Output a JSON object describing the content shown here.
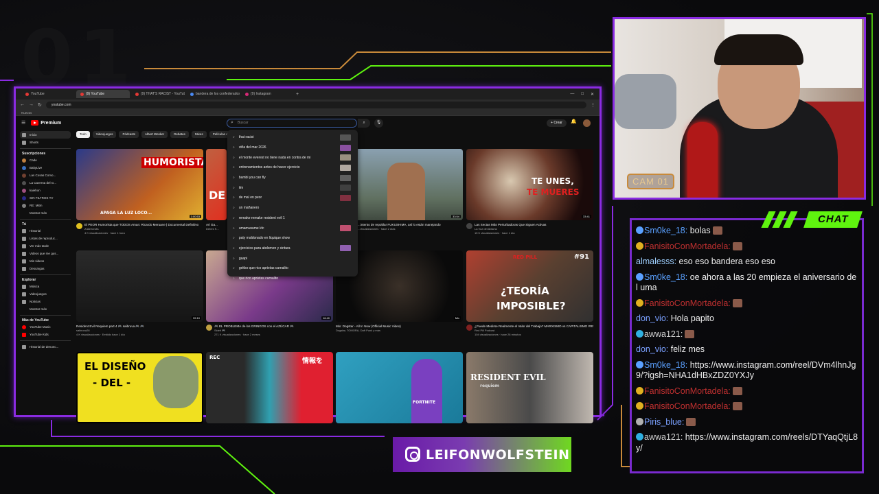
{
  "overlay": {
    "bg_number": "01",
    "cam_label": "CAM 01",
    "chat_label": "CHAT",
    "instagram_handle": "LEIFONWOLFSTEIN",
    "accent_purple": "#8a2be2",
    "accent_green": "#5ff30f"
  },
  "browser": {
    "tabs": [
      "YouTube",
      "(9) YouTube",
      "(9) THAT'S RACIST - YouTube",
      "bandera de los confederados",
      "(9) Instagram"
    ],
    "url": "youtube.com",
    "bookmark": "Nuevas"
  },
  "youtube": {
    "logo": "Premium",
    "search_placeholder": "Buscar",
    "create": "Crear",
    "sidebar": {
      "main": [
        "Inicio",
        "Shorts"
      ],
      "subs_header": "Suscripciones",
      "subs": [
        "Cade",
        "BaityLive",
        "Las Cosas Como...",
        "La Caverna del G...",
        "kaiehon",
        "SIN FILTROS TV",
        "RE: Mitm"
      ],
      "show_more": "Mostrar más",
      "you_header": "Tú",
      "you": [
        "Historial",
        "Listas de reproduc...",
        "Ver más tarde",
        "Videos que me gus...",
        "Mis videos",
        "Descargas"
      ],
      "explore_header": "Explorar",
      "explore": [
        "Música",
        "Videojuegos",
        "Noticias"
      ],
      "show_more_2": "Mostrar más",
      "more_header": "Más de YouTube",
      "more": [
        "YouTube Music",
        "YouTube Kids"
      ],
      "report": "Historial de denunc..."
    },
    "chips": [
      "Todo",
      "Videojuegos",
      "Pódcasts",
      "Albert Wesker",
      "Debates",
      "Mixes",
      "Películas de ...",
      "Novedad para ti"
    ],
    "suggestions": [
      "that racist",
      "viña del mar 2026",
      "el monte everest no tiene nada en contra de mi",
      "entrenamientos antes de hacer ejercicio",
      "bambi you can fly",
      "ilm",
      "de mal en peor",
      "un mañanero",
      "remake remake resident evil 1",
      "umamusume kfc",
      "paty maldonado en liquique show",
      "ejercicios para abdomen y cintura",
      "gaapi",
      "gekko que rico aprietas carnalito",
      "que rico aprietas carnalito"
    ],
    "videos": [
      {
        "title": "El PEOR Humorista que TODOS Aman: Ricardo Meruane | Documental Definitivo",
        "channel": "Zukirecruits",
        "meta": "4 K visualizaciones · hace 1 hora",
        "duration": "1:00:53",
        "overlay": "HUMORISTA",
        "overlay2": "APAGA LA LUZ LOCO..."
      },
      {
        "title": "Ari Ga...",
        "channel": "Debes S...",
        "meta": "Juan T...",
        "duration": "",
        "overlay": "DE",
        "overlay2": ""
      },
      {
        "title": "...intento de repoblar FUKUSHIMA, así lo están manejando",
        "channel": "...",
        "meta": "...visualizaciones · hace 2 días",
        "duration": "33:54",
        "overlay": "",
        "overlay2": ""
      },
      {
        "title": "Las Sectas Más Perturbadoras Que Siguen Activas",
        "channel": "La Voz del Abismo",
        "meta": "15 K visualizaciones · hace 1 día",
        "duration": "33:41",
        "overlay": "TE UNES,",
        "overlay2": "TE MUERES"
      },
      {
        "title": "Resident Evil Requiem part 4 🎮 saibruva 🎮 🎮",
        "channel": "saibruva26",
        "meta": "4 K visualizaciones · Emitido hace 1 día",
        "duration": "39:10",
        "overlay": "",
        "overlay2": ""
      },
      {
        "title": "🎮 EL PROBLEMA de los GRINGOS con el AZÚCAR 🎮",
        "channel": "Sideit 🎮",
        "meta": "271 K visualizaciones · hace 2 meses",
        "duration": "16:40",
        "overlay": "",
        "overlay2": ""
      },
      {
        "title": "Mix: Dogstar - All In Now (Official Music Video)",
        "channel": "Dogstar, TOMORA, Daft Punk y más",
        "meta": "",
        "duration": "Mix",
        "overlay": "",
        "overlay2": ""
      },
      {
        "title": "¿Puede Medirse Realmente el Valor del Trabajo? MARXISMO vs CAPITALISMO #RPP91",
        "channel": "Red Pill Podcast",
        "meta": "104 visualizaciones · hace 28 minutos",
        "duration": "",
        "overlay": "¿TEORÍA",
        "overlay2": "IMPOSIBLE?"
      },
      {
        "title": "",
        "channel": "",
        "meta": "",
        "duration": "",
        "overlay": "EL DISEÑO",
        "overlay2": "- DEL -"
      },
      {
        "title": "",
        "channel": "",
        "meta": "",
        "duration": "",
        "overlay": "情報を",
        "overlay2": "REC"
      },
      {
        "title": "",
        "channel": "",
        "meta": "",
        "duration": "",
        "overlay": "FORTNITE",
        "overlay2": ""
      },
      {
        "title": "",
        "channel": "",
        "meta": "",
        "duration": "",
        "overlay": "RESIDENT EVIL",
        "overlay2": "requiem"
      }
    ],
    "badges": {
      "v4": "#91",
      "v4_show": "RED PILL"
    }
  },
  "chat": [
    {
      "user": "Sm0ke_18",
      "user_color": "#5aa0ff",
      "text": " bolas",
      "emote": true,
      "badge": "sword"
    },
    {
      "user": "FanisitoConMortadela",
      "user_color": "#c03030",
      "text": "",
      "emote": true,
      "badge": "crown"
    },
    {
      "user": "almalesss",
      "user_color": "#9fd0ff",
      "text": " eso eso bandera eso eso",
      "emote": false,
      "badge": ""
    },
    {
      "user": "Sm0ke_18",
      "user_color": "#5aa0ff",
      "text": " oe ahora a las 20 empieza el aniversario del uma",
      "emote": false,
      "badge": "sword"
    },
    {
      "user": "FanisitoConMortadela",
      "user_color": "#c03030",
      "text": "",
      "emote": true,
      "badge": "crown"
    },
    {
      "user": "don_vio",
      "user_color": "#7aa0ff",
      "text": " Hola papito",
      "emote": false,
      "badge": ""
    },
    {
      "user": "awwa121",
      "user_color": "#d0d0d0",
      "text": "",
      "emote": true,
      "badge": "gem"
    },
    {
      "user": "don_vio",
      "user_color": "#7aa0ff",
      "text": " feliz mes",
      "emote": false,
      "badge": ""
    },
    {
      "user": "Sm0ke_18",
      "user_color": "#5aa0ff",
      "text": " https://www.instagram.com/reel/DVm4lhnJg9/?igsh=NHA1dHBxZDZ0YXJy",
      "emote": false,
      "badge": "sword"
    },
    {
      "user": "FanisitoConMortadela",
      "user_color": "#c03030",
      "text": "",
      "emote": true,
      "badge": "crown"
    },
    {
      "user": "FanisitoConMortadela",
      "user_color": "#c03030",
      "text": "",
      "emote": true,
      "badge": "crown"
    },
    {
      "user": "Piris_blue",
      "user_color": "#7aa0ff",
      "text": "",
      "emote": true,
      "badge": "dot"
    },
    {
      "user": "awwa121",
      "user_color": "#d0d0d0",
      "text": " https://www.instagram.com/reels/DTYaqQtjL8y/",
      "emote": false,
      "badge": "gem"
    }
  ]
}
